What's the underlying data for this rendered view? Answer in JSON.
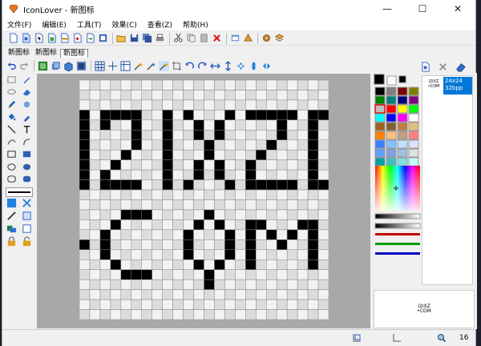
{
  "window": {
    "title": "IconLover - 新图标",
    "minimize": "—",
    "maximize": "☐",
    "close": "✕"
  },
  "menu": [
    {
      "label": "文件(F)"
    },
    {
      "label": "编辑(E)"
    },
    {
      "label": "工具(T)"
    },
    {
      "label": "效果(C)"
    },
    {
      "label": "查看(Z)"
    },
    {
      "label": "帮助(H)"
    }
  ],
  "tabs": [
    {
      "label": "新图标"
    },
    {
      "label": "新图标"
    },
    {
      "label": "新图标"
    }
  ],
  "icon_pixels": {
    "size": 24,
    "rows": [
      "........................",
      "........................",
      "........................",
      "#.####..#.#...#.#####.##",
      "#.#..#..#..#.#.....#..#.",
      "#....#..#..#.#.....#..#.",
      "#....#..#...#.....#...#.",
      "#...#...#...#....#....#.",
      "#..#....#..#.#..#.....#.",
      "#.#.....#..#.#..#.....#.",
      "#.####..#.#...#.#####.##",
      "........................",
      "........................",
      "....###.....#...........",
      "...#.......#.#..##...##.",
      "..#.......#...#.#.#.#.#.",
      "#.#.......#...#.#..#..#.",
      "..#.......#...#.#.....#.",
      "...#.......#.#..#.....#.",
      "....###.....#...........",
      "............#...........",
      "........................",
      "........................",
      "........................"
    ]
  },
  "palette": {
    "primary": "#000000",
    "secondary": "#ffffff",
    "swatches": [
      "#000000",
      "#808080",
      "#800000",
      "#808000",
      "#008000",
      "#008080",
      "#000080",
      "#800080",
      "#c0c0c0",
      "#ff0000",
      "#ffff00",
      "#00ff00",
      "#00ffff",
      "#0000ff",
      "#ff00ff",
      "#ffffff",
      "#a06020",
      "#806030",
      "#c08040",
      "#e0c080",
      "#ff8000",
      "#ffc080",
      "#c0a080",
      "#ff8080",
      "#4080ff",
      "#80c0ff",
      "#c0e0ff",
      "#e0e0ff",
      "#60a0ff",
      "#80a0e0",
      "#a0c0e0",
      "#e0e0e0",
      "#00a0a0",
      "#40c0c0",
      "#80e0e0",
      "#c0ffff"
    ]
  },
  "formats": [
    {
      "size": "24x24",
      "depth": "32bpp",
      "thumb": "I2IXZ\n•COM"
    }
  ],
  "preview": {
    "text": "I2IXZ\n•COM"
  },
  "status": {
    "zoom": "16"
  },
  "colors": {
    "selection": "#0078d7",
    "canvas_bg": "#a8a8a8"
  }
}
